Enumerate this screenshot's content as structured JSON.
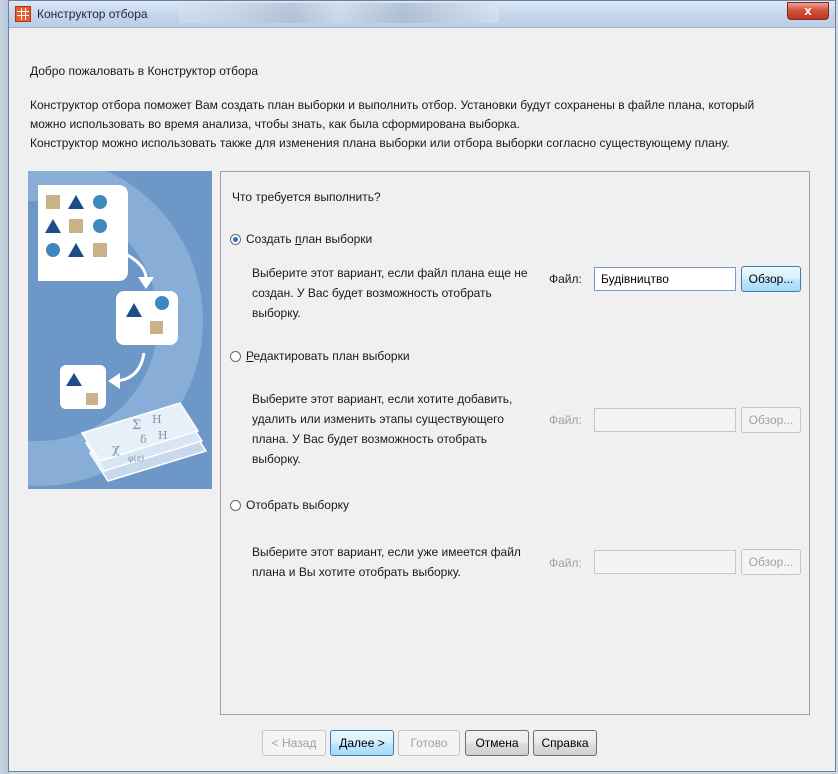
{
  "window": {
    "title": "Конструктор отбора",
    "close_symbol": "x"
  },
  "welcome": "Добро пожаловать в Конструктор отбора",
  "intro_lines": [
    "Конструктор отбора поможет Вам создать план выборки и выполнить отбор. Установки  будут сохранены в файле плана, который",
    "можно использовать во время анализа, чтобы знать, как была сформирована выборка.",
    "Конструктор можно использовать также для изменения плана выборки или отбора выборки согласно существующему плану."
  ],
  "illustration": {
    "formula_symbols": [
      "Σ",
      "H",
      "δ",
      "H",
      "χ",
      "φ(z)"
    ]
  },
  "question": "Что требуется выполнить?",
  "options": [
    {
      "label_before": "Создать ",
      "label_mnemonic": "п",
      "label_after": "лан выборки",
      "checked": true,
      "description": "Выберите этот вариант, если файл плана еще не создан. У Вас будет возможность отобрать выборку.",
      "file_label": "Файл:",
      "file_value": "Будівництво",
      "browse_label": "Обзор...",
      "enabled": true
    },
    {
      "label_before": "",
      "label_mnemonic": "Р",
      "label_after": "едактировать план выборки",
      "checked": false,
      "description": "Выберите этот вариант, если хотите добавить, удалить или изменить этапы существующего плана. У Вас будет возможность отобрать выборку.",
      "file_label": "Файл:",
      "file_value": "",
      "browse_label": "Обзор...",
      "enabled": false
    },
    {
      "label_before": "Отобрать выборку",
      "label_mnemonic": "",
      "label_after": "",
      "checked": false,
      "description": "Выберите этот вариант, если уже имеется файл плана и Вы  хотите отобрать выборку.",
      "file_label": "Файл:",
      "file_value": "",
      "browse_label": "Обзор...",
      "enabled": false
    }
  ],
  "footer": {
    "back": "< Назад",
    "next": "Далее >",
    "finish": "Готово",
    "cancel": "Отмена",
    "help": "Справка"
  }
}
